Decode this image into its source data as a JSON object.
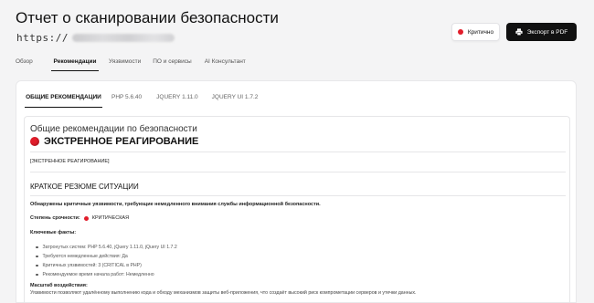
{
  "header": {
    "title": "Отчет о сканировании безопасности",
    "url_prefix": "https://"
  },
  "actions": {
    "critical_badge": "Критично",
    "export_button": "Экспорт в PDF"
  },
  "tabs": [
    {
      "label": "Обзор",
      "active": false
    },
    {
      "label": "Рекомендации",
      "active": true
    },
    {
      "label": "Уязвимости",
      "active": false
    },
    {
      "label": "ПО и сервисы",
      "active": false
    },
    {
      "label": "AI Консультант",
      "active": false
    }
  ],
  "subtabs": [
    {
      "label": "ОБЩИЕ РЕКОМЕНДАЦИИ",
      "active": true
    },
    {
      "label": "PHP 5.6.40",
      "active": false
    },
    {
      "label": "JQUERY 1.11.0",
      "active": false
    },
    {
      "label": "JQUERY UI 1.7.2",
      "active": false
    }
  ],
  "content": {
    "general_heading": "Общие рекомендации по безопасности",
    "emergency_heading": "ЭКСТРЕННОЕ РЕАГИРОВАНИЕ",
    "emergency_tag": "[ЭКСТРЕННОЕ РЕАГИРОВАНИЕ]",
    "summary_heading": "КРАТКОЕ РЕЗЮМЕ СИТУАЦИИ",
    "detected": "Обнаружены критичные уязвимости, требующие немедленного внимания службы информационной безопасности.",
    "severity_label": "Степень срочности:",
    "severity_value": "КРИТИЧЕСКАЯ",
    "key_facts_label": "Ключевые факты:",
    "key_facts": [
      "Затронутых систем: PHP 5.6.40, jQuery 1.11.0, jQuery UI 1.7.2",
      "Требуются немедленные действия: Да",
      "Критичных уязвимостей: 3 (CRITICAL в PHP)",
      "Рекомендуемое время начала работ: Немедленно"
    ],
    "impact_label": "Масштаб воздействия:",
    "impact_text": "Уязвимости позволяют удалённому выполнению кода и обходу механизмов защиты веб-приложения, что создаёт высокий риск компрометации серверов и утечки данных."
  },
  "colors": {
    "critical": "#e11d2b",
    "button_dark": "#111111",
    "background": "#f4f4f5"
  }
}
